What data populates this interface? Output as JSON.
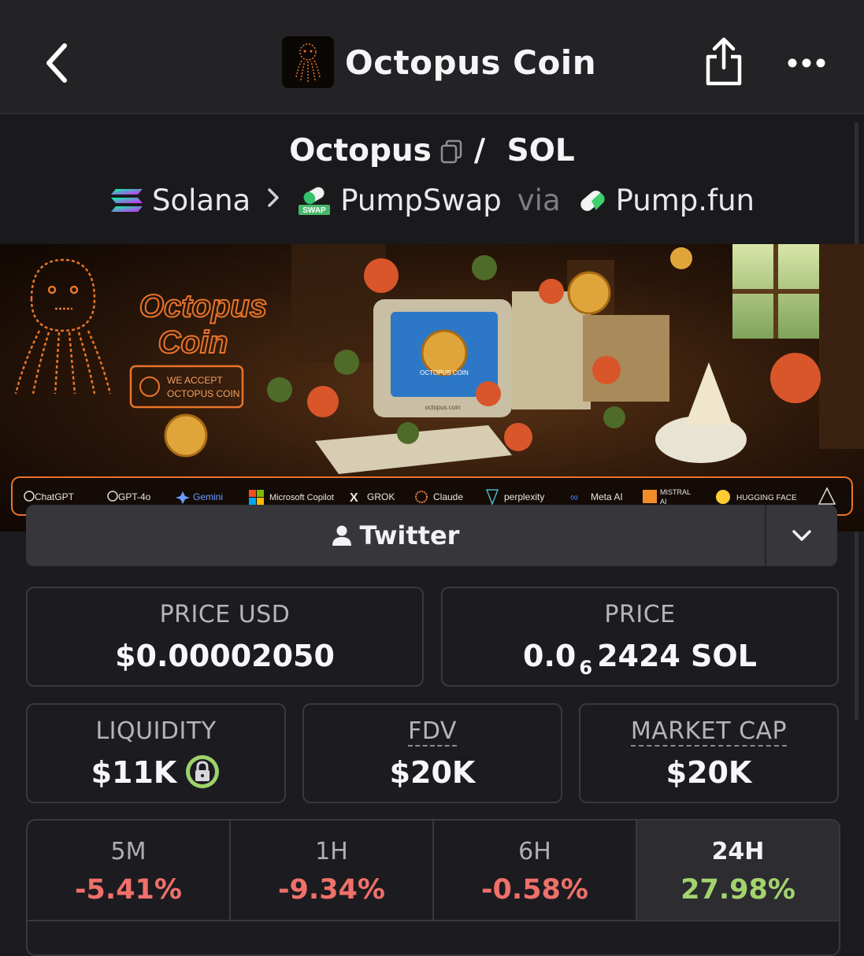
{
  "header": {
    "title": "Octopus Coin",
    "back_icon": "chevron-left-icon",
    "share_icon": "share-icon",
    "more_icon": "more-horizontal-icon"
  },
  "pair": {
    "base": "Octopus",
    "slash": "/",
    "quote": "SOL",
    "chain": "Solana",
    "dex": "PumpSwap",
    "via": "via",
    "launchpad": "Pump.fun",
    "dex_badge": "SWAP"
  },
  "banner": {
    "logo_line1": "Octopus",
    "logo_line2": "Coin",
    "accept_line1": "WE ACCEPT",
    "accept_line2": "OCTOPUS COIN",
    "screen_text": "OCTOPUS COIN",
    "site_text": "octopus.coin",
    "ai_logos": [
      "ChatGPT",
      "GPT-4o",
      "Gemini",
      "Microsoft Copilot",
      "GROK",
      "Claude",
      "perplexity",
      "Meta AI",
      "MISTRAL",
      "AI",
      "HUGGING FACE"
    ]
  },
  "social": {
    "label": "Twitter"
  },
  "stats": {
    "price_usd_label": "PRICE USD",
    "price_usd": "$0.00002050",
    "price_label": "PRICE",
    "price_sol_prefix": "0.0",
    "price_sol_zeros": "6",
    "price_sol_rest": "2424 SOL",
    "liquidity_label": "LIQUIDITY",
    "liquidity": "$11K",
    "fdv_label": "FDV",
    "fdv": "$20K",
    "mcap_label": "MARKET CAP",
    "mcap": "$20K"
  },
  "timeframes": [
    {
      "label": "5M",
      "change": "-5.41%"
    },
    {
      "label": "1H",
      "change": "-9.34%"
    },
    {
      "label": "6H",
      "change": "-0.58%"
    },
    {
      "label": "24H",
      "change": "27.98%"
    }
  ],
  "colors": {
    "negative": "#f0706a",
    "positive": "#a3d36d",
    "accent_orange": "#e8742a"
  }
}
